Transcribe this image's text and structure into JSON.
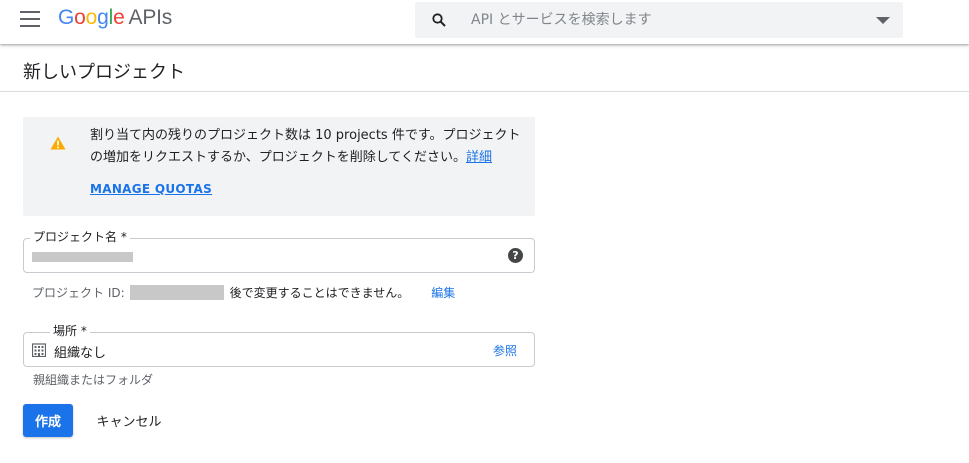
{
  "header": {
    "logo": {
      "g1": "G",
      "o1": "o",
      "o2": "o",
      "g2": "g",
      "l": "l",
      "e": "e",
      "suffix": "APIs"
    },
    "search": {
      "placeholder": "API とサービスを検索します"
    }
  },
  "page": {
    "title": "新しいプロジェクト"
  },
  "warning": {
    "text": "割り当て内の残りのプロジェクト数は 10 projects 件です。プロジェクトの増加をリクエストするか、プロジェクトを削除してください。",
    "details_link": "詳細",
    "manage_quotas": "MANAGE QUOTAS"
  },
  "form": {
    "project_name": {
      "label": "プロジェクト名 *",
      "value": ""
    },
    "project_id": {
      "prefix": "プロジェクト ID:",
      "suffix": "後で変更することはできません。",
      "edit_label": "編集"
    },
    "location": {
      "label": "場所 *",
      "value": "組織なし",
      "browse_label": "参照",
      "helper": "親組織またはフォルダ"
    },
    "create_label": "作成",
    "cancel_label": "キャンセル"
  },
  "colors": {
    "accent": "#1a73e8",
    "warning_icon": "#f9ab00",
    "panel_bg": "#f1f3f4"
  },
  "icons": {
    "menu": "menu-icon",
    "search": "search-icon",
    "dropdown": "chevron-down-icon",
    "warning": "warning-icon",
    "help": "help-icon",
    "organization": "building-icon"
  }
}
